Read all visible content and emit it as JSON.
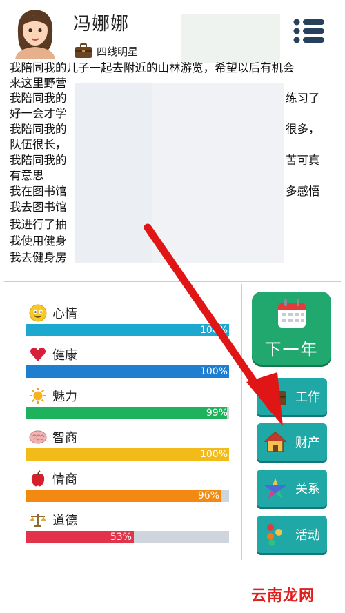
{
  "header": {
    "name": "冯娜娜",
    "rank": "四线明星",
    "menu_icon": "menu-icon"
  },
  "log_lines": [
    "我陪同我的儿子一起去附近的山林游览，希望以后有机会",
    "来这里野营",
    "我陪同我的",
    "练习了",
    "好一会才学",
    "我陪同我的",
    "很多，",
    "队伍很长，",
    "我陪同我的",
    "苦可真",
    "有意思",
    "我在图书馆",
    "多感悟",
    "我去图书馆",
    "我进行了抽",
    "我使用健身",
    "我去健身房"
  ],
  "stats": [
    {
      "label": "心情",
      "percent": 100,
      "percent_text": "100%",
      "color": "#1da8cf",
      "icon": "smiley-icon"
    },
    {
      "label": "健康",
      "percent": 100,
      "percent_text": "100%",
      "color": "#1e7fd1",
      "icon": "heart-icon"
    },
    {
      "label": "魅力",
      "percent": 99,
      "percent_text": "99%",
      "color": "#1fb25c",
      "icon": "sun-icon"
    },
    {
      "label": "智商",
      "percent": 100,
      "percent_text": "100%",
      "color": "#f2bb1a",
      "icon": "brain-icon"
    },
    {
      "label": "情商",
      "percent": 96,
      "percent_text": "96%",
      "color": "#f28a12",
      "icon": "apple-icon"
    },
    {
      "label": "道德",
      "percent": 53,
      "percent_text": "53%",
      "color": "#e2334b",
      "icon": "scales-icon"
    }
  ],
  "buttons": {
    "next_year": "下一年",
    "work": "工作",
    "wealth": "财产",
    "relations": "关系",
    "activities": "活动"
  },
  "watermark": "云南龙网"
}
